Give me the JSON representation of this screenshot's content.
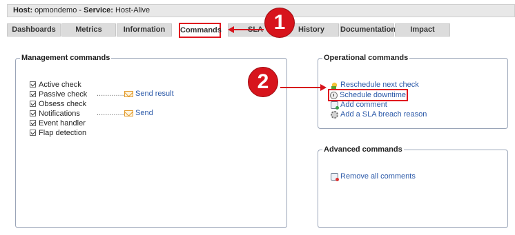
{
  "header": {
    "host_label": "Host:",
    "host_value": "opmondemo",
    "separator": "-",
    "service_label": "Service:",
    "service_value": "Host-Alive"
  },
  "tabs": [
    {
      "label": "Dashboards"
    },
    {
      "label": "Metrics"
    },
    {
      "label": "Information"
    },
    {
      "label": "Commands",
      "active": true
    },
    {
      "label": "SLA"
    },
    {
      "label": "History"
    },
    {
      "label": "Documentation"
    },
    {
      "label": "Impact"
    }
  ],
  "management": {
    "title": "Management commands",
    "items": [
      {
        "label": "Active check",
        "checked": true
      },
      {
        "label": "Passive check",
        "checked": true,
        "dots": "...............",
        "action": "Send result",
        "action_icon": "envelope-icon"
      },
      {
        "label": "Obsess check",
        "checked": true
      },
      {
        "label": "Notifications",
        "checked": true,
        "dots": "...............",
        "action": "Send",
        "action_icon": "envelope-icon"
      },
      {
        "label": "Event handler",
        "checked": true
      },
      {
        "label": "Flap detection",
        "checked": true
      }
    ]
  },
  "operational": {
    "title": "Operational commands",
    "items": [
      {
        "label": "Reschedule next check",
        "icon": "reschedule-icon"
      },
      {
        "label": "Schedule downtime",
        "icon": "clock-icon",
        "highlighted": true
      },
      {
        "label": "Add comment",
        "icon": "comment-icon"
      },
      {
        "label": "Add a SLA breach reason",
        "icon": "gear-icon"
      }
    ]
  },
  "advanced": {
    "title": "Advanced commands",
    "items": [
      {
        "label": "Remove all comments",
        "icon": "remove-comment-icon"
      }
    ]
  },
  "annotations": [
    {
      "number": "1",
      "color": "#d7141c"
    },
    {
      "number": "2",
      "color": "#d7141c"
    }
  ]
}
